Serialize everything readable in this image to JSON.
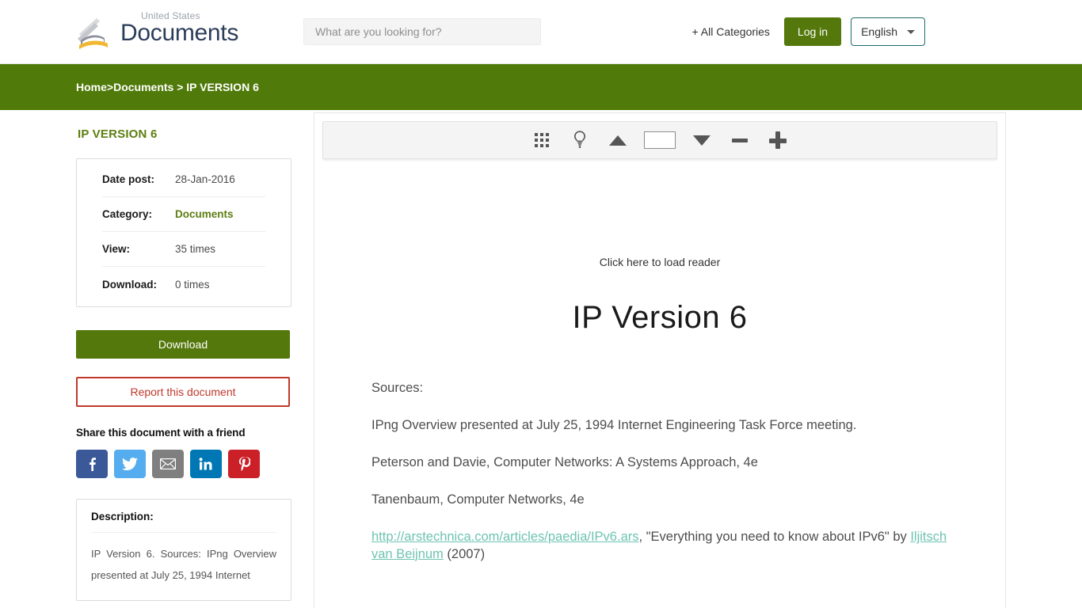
{
  "header": {
    "logo": {
      "sub": "United States",
      "main": "Documents",
      "icon": "open-book-icon"
    },
    "search": {
      "placeholder": "What are you looking for?",
      "value": ""
    },
    "all_categories": "+ All Categories",
    "login_label": "Log in",
    "language": "English"
  },
  "breadcrumb": {
    "home": "Home",
    "sep1": ">",
    "documents": "Documents",
    "sep2": ">",
    "current": "IP VERSION 6"
  },
  "sidebar": {
    "title": "IP VERSION 6",
    "info": [
      {
        "label": "Date post:",
        "value": "28-Jan-2016",
        "is_link": false
      },
      {
        "label": "Category:",
        "value": "Documents",
        "is_link": true
      },
      {
        "label": "View:",
        "value": "35 times",
        "is_link": false
      },
      {
        "label": "Download:",
        "value": "0 times",
        "is_link": false
      }
    ],
    "download_label": "Download",
    "report_label": "Report this document",
    "share_title": "Share this document with a friend",
    "share_buttons": [
      {
        "name": "facebook",
        "label": "f"
      },
      {
        "name": "twitter",
        "label": ""
      },
      {
        "name": "email",
        "label": ""
      },
      {
        "name": "linkedin",
        "label": "in"
      },
      {
        "name": "pinterest",
        "label": ""
      }
    ],
    "description_title": "Description:",
    "description_body": "IP Version 6. Sources: IPng Overview presented at July 25, 1994 Internet"
  },
  "viewer": {
    "toolbar": {
      "grid_icon": "grid-icon",
      "lightbulb_icon": "lightbulb-icon",
      "prev_icon": "triangle-up-icon",
      "page_value": "",
      "next_icon": "triangle-down-icon",
      "zoom_out_icon": "minus-icon",
      "zoom_in_icon": "plus-icon"
    },
    "reader_hint": "Click here to load reader",
    "document": {
      "heading": "IP Version 6",
      "lines": [
        "Sources:",
        "IPng Overview presented at July 25, 1994 Internet Engineering Task Force meeting.",
        "Peterson and Davie, Computer Networks: A Systems Approach, 4e",
        "Tanenbaum, Computer Networks, 4e"
      ],
      "last_line": {
        "url": "http://arstechnica.com/articles/paedia/IPv6.ars",
        "mid": ", \"Everything you need to know about IPv6\" by ",
        "author": "Iljitsch van Beijnum",
        "year": " (2007)"
      }
    }
  },
  "colors": {
    "brand_green": "#54780b",
    "breadcrumb_green": "#507a09",
    "title_green": "#5c7e10",
    "report_red": "#c0392b",
    "doc_link_teal": "#6ec4b0"
  }
}
